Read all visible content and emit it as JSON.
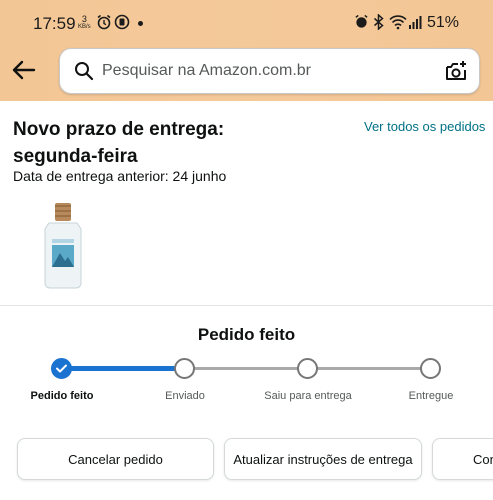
{
  "status_bar": {
    "time": "17:59",
    "data_speed_value": "3",
    "data_speed_unit": "KB/s",
    "battery": "51%"
  },
  "header": {
    "search_placeholder": "Pesquisar na Amazon.com.br",
    "icons": [
      "back-arrow-icon",
      "search-icon",
      "camera-search-icon"
    ]
  },
  "order": {
    "title": "Novo prazo de entrega: segunda-feira",
    "view_all_link": "Ver todos os pedidos",
    "previous_date": "Data de entrega anterior: 24 junho"
  },
  "tracker": {
    "title": "Pedido feito",
    "progress_fraction": 0.33,
    "steps": [
      {
        "label": "Pedido feito",
        "done": true
      },
      {
        "label": "Enviado",
        "done": false
      },
      {
        "label": "Saiu para entrega",
        "done": false
      },
      {
        "label": "Entregue",
        "done": false
      }
    ]
  },
  "actions": {
    "cancel": "Cancelar pedido",
    "update": "Atualizar instruções de entrega",
    "more": "Con"
  },
  "colors": {
    "header_bg": "#f3c695",
    "progress_blue": "#1a73d1",
    "link": "#007185"
  }
}
